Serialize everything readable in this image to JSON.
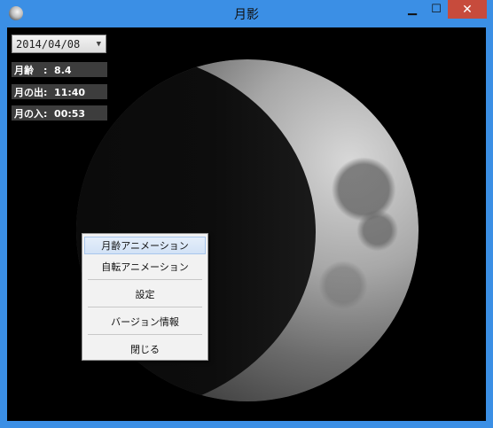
{
  "window": {
    "title": "月影"
  },
  "titlebar_buttons": {
    "minimize": "▁",
    "maximize": "☐",
    "close": "✕"
  },
  "date_picker": {
    "value": "2014/04/08"
  },
  "info": {
    "moon_age": "月齢　:  8.4",
    "moonrise": "月の出:  11:40",
    "moonset": "月の入:  00:53"
  },
  "context_menu": {
    "items": [
      {
        "label": "月齢アニメーション"
      },
      {
        "label": "自転アニメーション"
      },
      {
        "label": "設定"
      },
      {
        "label": "バージョン情報"
      },
      {
        "label": "閉じる"
      }
    ]
  }
}
